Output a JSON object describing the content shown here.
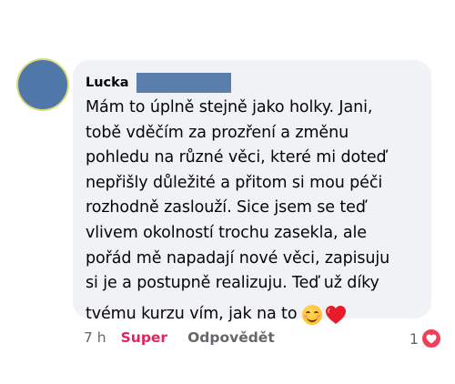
{
  "comment": {
    "author": "Lucka",
    "lines": [
      "Mám to úplně stejně jako holky. Jani,",
      "tobě vděčím za prozření a změnu",
      "pohledu na různé věci, které mi doteď",
      "nepřišly důležité a přitom si mou péči",
      "rozhodně zaslouží. Sice jsem se teď",
      "vlivem okolností trochu zasekla, ale",
      "pořád mě napadají nové věci, zapisuju",
      "si je a postupně realizuju. Teď už díky",
      "tvému kurzu vím, jak na to"
    ],
    "emojis": [
      "smiling-face-icon",
      "red-heart-icon"
    ]
  },
  "meta": {
    "time": "7 h",
    "reaction_label": "Super",
    "reply_label": "Odpovědět",
    "reaction_count": "1",
    "reaction_icon": "love-reaction-icon"
  },
  "colors": {
    "bubble": "#f0f2f5",
    "avatar": "#4f78a8",
    "redaction": "#5a7fad",
    "react_link": "#e0245e",
    "muted_text": "#65676b",
    "love_reaction": "#f33e58"
  }
}
